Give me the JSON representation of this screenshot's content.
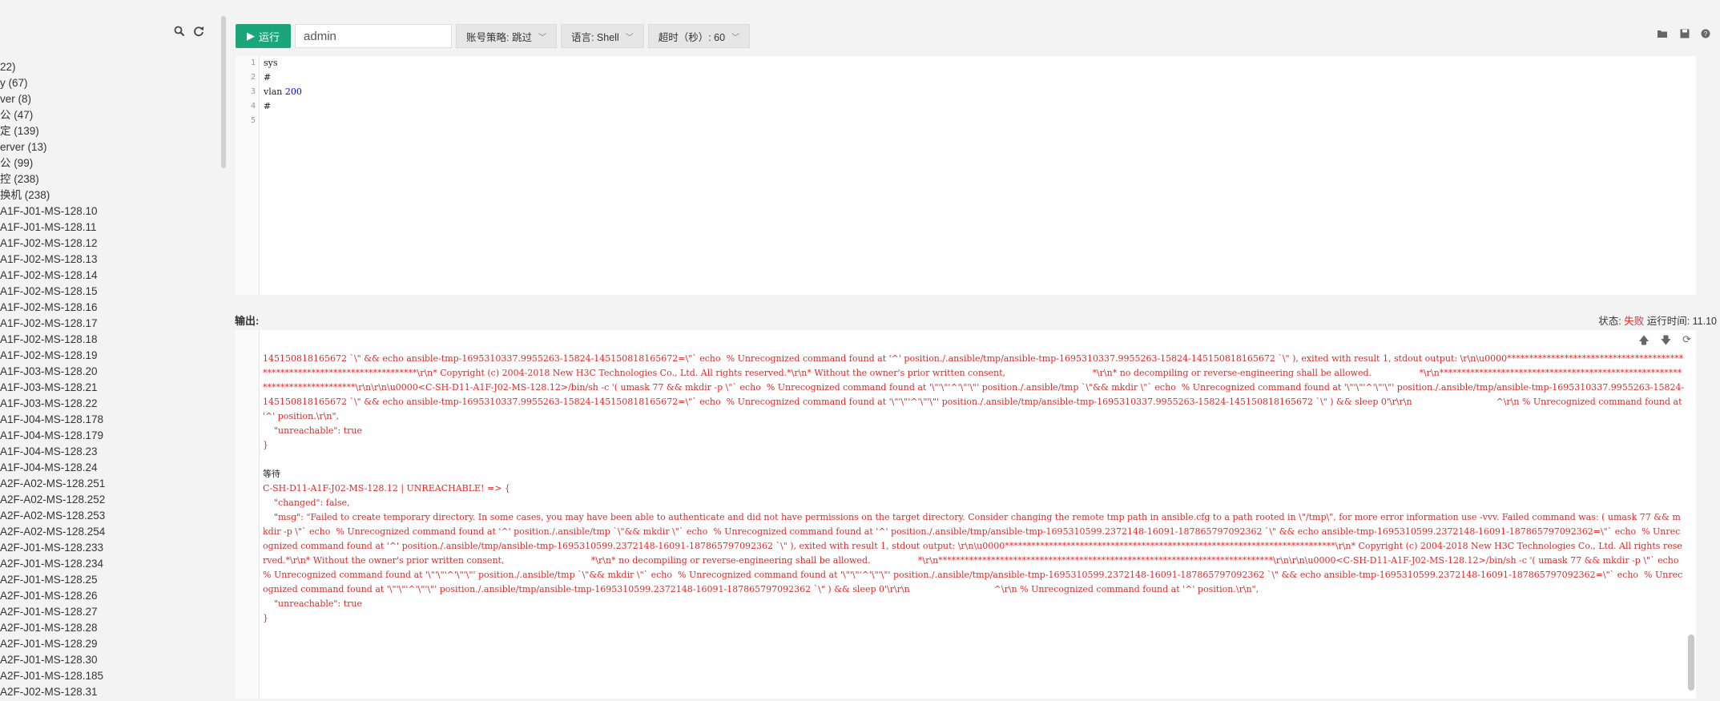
{
  "sidebar": {
    "tree": [
      "22)",
      "y (67)",
      "ver (8)",
      "公 (47)",
      "定 (139)",
      "erver (13)",
      "公 (99)",
      "控 (238)",
      "换机 (238)",
      "A1F-J01-MS-128.10",
      "A1F-J01-MS-128.11",
      "A1F-J02-MS-128.12",
      "A1F-J02-MS-128.13",
      "A1F-J02-MS-128.14",
      "A1F-J02-MS-128.15",
      "A1F-J02-MS-128.16",
      "A1F-J02-MS-128.17",
      "A1F-J02-MS-128.18",
      "A1F-J02-MS-128.19",
      "A1F-J03-MS-128.20",
      "A1F-J03-MS-128.21",
      "A1F-J03-MS-128.22",
      "A1F-J04-MS-128.178",
      "A1F-J04-MS-128.179",
      "A1F-J04-MS-128.23",
      "A1F-J04-MS-128.24",
      "A2F-A02-MS-128.251",
      "A2F-A02-MS-128.252",
      "A2F-A02-MS-128.253",
      "A2F-A02-MS-128.254",
      "A2F-J01-MS-128.233",
      "A2F-J01-MS-128.234",
      "A2F-J01-MS-128.25",
      "A2F-J01-MS-128.26",
      "A2F-J01-MS-128.27",
      "A2F-J01-MS-128.28",
      "A2F-J01-MS-128.29",
      "A2F-J01-MS-128.30",
      "A2F-J01-MS-128.185",
      "A2F-J02-MS-128.31"
    ]
  },
  "toolbar": {
    "run_label": "运行",
    "user_value": "admin",
    "account_policy": "账号策略: 跳过",
    "language": "语言: Shell",
    "timeout": "超时（秒）: 60"
  },
  "editor": {
    "line_numbers": [
      "1",
      "2",
      "3",
      "4",
      "5"
    ],
    "line1": "sys",
    "line2": "#",
    "line3_kw": "vlan ",
    "line3_num": "200",
    "line4": "#",
    "line5": ""
  },
  "output": {
    "label": "输出:",
    "status_label": "状态: ",
    "status_value": "失败",
    "runtime_label": " 运行时间: ",
    "runtime_value": "11.10",
    "block1": "145150818165672 `\\\" && echo ansible-tmp-1695310337.9955263-15824-145150818165672=\\\"` echo  % Unrecognized command found at '^' position./.ansible/tmp/ansible-tmp-1695310337.9955263-15824-145150818165672 `\\\" ), exited with result 1, stdout output: \\r\\n\\u0000***************************************************************************\\r\\n* Copyright (c) 2004-2018 New H3C Technologies Co., Ltd. All rights reserved.*\\r\\n* Without the owner's prior written consent,                               *\\r\\n* no decompiling or reverse-engineering shall be allowed.                 *\\r\\n****************************************************************************\\r\\n\\r\\n\\u0000<C-SH-D11-A1F-J02-MS-128.12>/bin/sh -c '( umask 77 && mkdir -p \\\"` echo  % Unrecognized command found at '\\\"'\\\"'^'\\\"'\\\"' position./.ansible/tmp `\\\"&& mkdir \\\"` echo  % Unrecognized command found at '\\\"'\\\"'^'\\\"'\\\"' position./.ansible/tmp/ansible-tmp-1695310337.9955263-15824-145150818165672 `\\\" && echo ansible-tmp-1695310337.9955263-15824-145150818165672=\\\"` echo  % Unrecognized command found at '\\\"'\\\"'^'\\\"'\\\"' position./.ansible/tmp/ansible-tmp-1695310337.9955263-15824-145150818165672 `\\\" ) && sleep 0'\\r\\r\\n                              ^\\r\\n % Unrecognized command found at '^' position.\\r\\n\",\n    \"unreachable\": true\n}",
    "waiting": "等待",
    "block2": "C-SH-D11-A1F-J02-MS-128.12 | UNREACHABLE! => {\n    \"changed\": false,\n    \"msg\": \"Failed to create temporary directory. In some cases, you may have been able to authenticate and did not have permissions on the target directory. Consider changing the remote tmp path in ansible.cfg to a path rooted in \\\"/tmp\\\", for more error information use -vvv. Failed command was: ( umask 77 && mkdir -p \\\"` echo  % Unrecognized command found at '^' position./.ansible/tmp `\\\"&& mkdir \\\"` echo  % Unrecognized command found at '^' position./.ansible/tmp/ansible-tmp-1695310599.2372148-16091-187865797092362 `\\\" && echo ansible-tmp-1695310599.2372148-16091-187865797092362=\\\"` echo  % Unrecognized command found at '^' position./.ansible/tmp/ansible-tmp-1695310599.2372148-16091-187865797092362 `\\\" ), exited with result 1, stdout output: \\r\\n\\u0000***************************************************************************\\r\\n* Copyright (c) 2004-2018 New H3C Technologies Co., Ltd. All rights reserved.*\\r\\n* Without the owner's prior written consent,                               *\\r\\n* no decompiling or reverse-engineering shall be allowed.                 *\\r\\n****************************************************************************\\r\\n\\r\\n\\u0000<C-SH-D11-A1F-J02-MS-128.12>/bin/sh -c '( umask 77 && mkdir -p \\\"` echo  % Unrecognized command found at '\\\"'\\\"'^'\\\"'\\\"' position./.ansible/tmp `\\\"&& mkdir \\\"` echo  % Unrecognized command found at '\\\"'\\\"'^'\\\"'\\\"' position./.ansible/tmp/ansible-tmp-1695310599.2372148-16091-187865797092362 `\\\" && echo ansible-tmp-1695310599.2372148-16091-187865797092362=\\\"` echo  % Unrecognized command found at '\\\"'\\\"'^'\\\"'\\\"' position./.ansible/tmp/ansible-tmp-1695310599.2372148-16091-187865797092362 `\\\" ) && sleep 0'\\r\\r\\n                              ^\\r\\n % Unrecognized command found at '^' position.\\r\\n\",\n    \"unreachable\": true\n}"
  }
}
